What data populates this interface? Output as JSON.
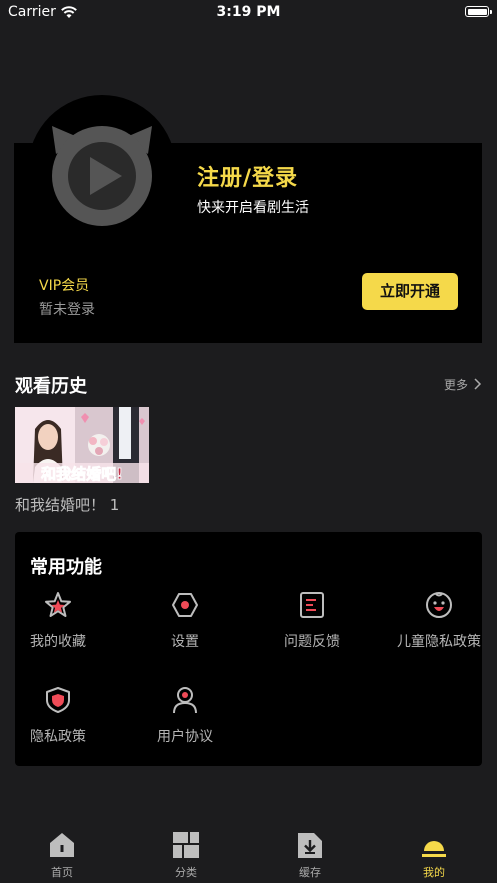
{
  "status_bar": {
    "carrier": "Carrier",
    "time": "3:19 PM"
  },
  "profile": {
    "title": "注册/登录",
    "subtitle": "快来开启看剧生活",
    "vip_label": "VIP会员",
    "vip_status": "暂未登录",
    "open_button": "立即开通"
  },
  "history": {
    "title": "观看历史",
    "more": "更多",
    "items": [
      {
        "caption": "和我结婚吧！ 1",
        "poster_text": "和我结婚吧!"
      }
    ]
  },
  "functions": {
    "title": "常用功能",
    "items": [
      {
        "label": "我的收藏",
        "icon": "star-icon"
      },
      {
        "label": "设置",
        "icon": "settings-hexagon-icon"
      },
      {
        "label": "问题反馈",
        "icon": "feedback-document-icon"
      },
      {
        "label": "儿童隐私政策",
        "icon": "child-face-icon"
      },
      {
        "label": "隐私政策",
        "icon": "shield-icon"
      },
      {
        "label": "用户协议",
        "icon": "user-icon"
      }
    ]
  },
  "tabs": [
    {
      "label": "首页",
      "icon": "home-icon",
      "active": false
    },
    {
      "label": "分类",
      "icon": "category-grid-icon",
      "active": false
    },
    {
      "label": "缓存",
      "icon": "download-folder-icon",
      "active": false
    },
    {
      "label": "我的",
      "icon": "profile-icon",
      "active": true
    }
  ],
  "colors": {
    "accent": "#f5d94a",
    "background": "#1c1c1e",
    "card": "#000000",
    "icon_red": "#ef4b57"
  }
}
